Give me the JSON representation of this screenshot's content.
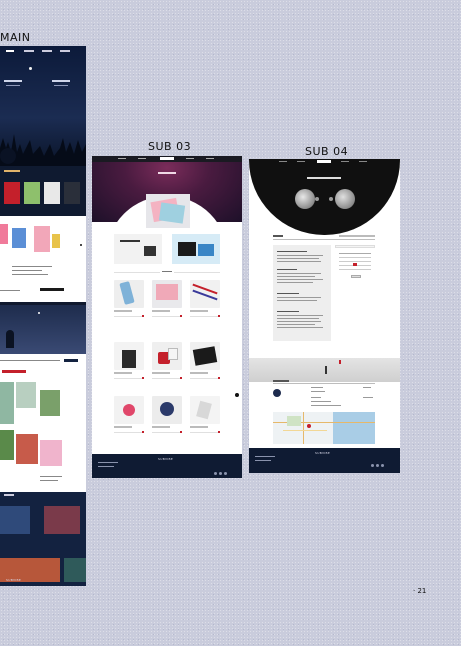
{
  "labels": {
    "main": "MAIN",
    "sub03": "SUB 03",
    "sub04": "SUB 04"
  },
  "page_number": "· 21",
  "colors": {
    "background": "#c9ccdc",
    "navy": "#0f1b33",
    "accent_red": "#c4202b"
  }
}
